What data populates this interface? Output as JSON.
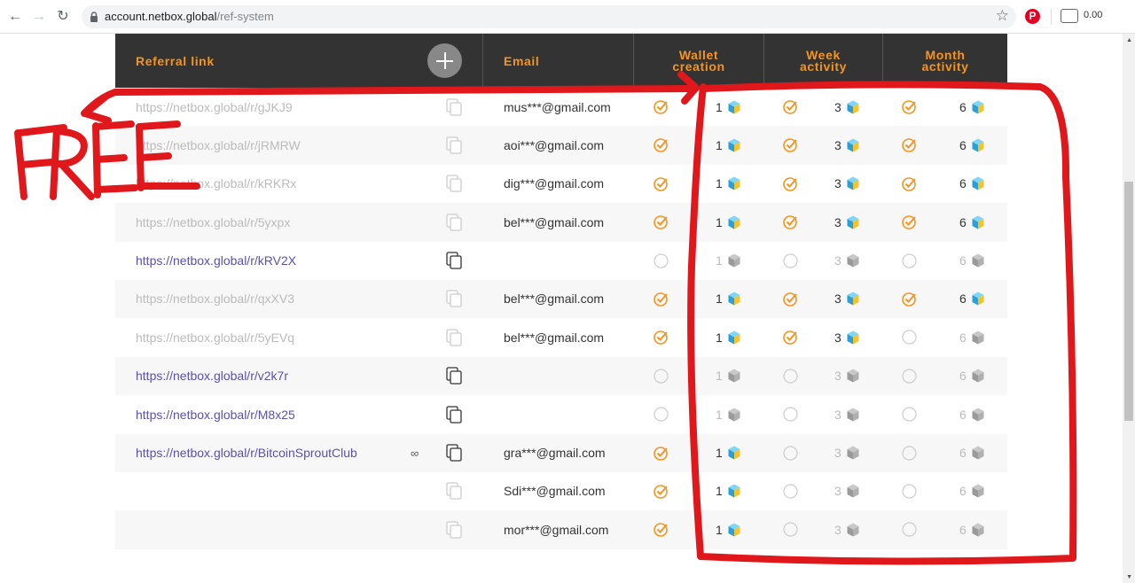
{
  "browser": {
    "back_icon": "arrow-left-icon",
    "forward_icon": "arrow-right-icon",
    "reload_icon": "reload-icon",
    "url_host": "account.netbox.global",
    "url_path": "/ref-system",
    "extension_value": "0.00"
  },
  "table": {
    "headers": {
      "referral_link": "Referral link",
      "email": "Email",
      "wallet_line1": "Wallet",
      "wallet_line2": "creation",
      "week_line1": "Week",
      "week_line2": "activity",
      "month_line1": "Month",
      "month_line2": "activity"
    },
    "rows": [
      {
        "link": "https://netbox.global/r/gJKJ9",
        "email": "mus***@gmail.com",
        "active": false,
        "infinity": "",
        "wallet": true,
        "wallet_reward": "1",
        "week": true,
        "week_reward": "3",
        "month": true,
        "month_reward": "6"
      },
      {
        "link": "https://netbox.global/r/jRMRW",
        "email": "aoi***@gmail.com",
        "active": false,
        "infinity": "",
        "wallet": true,
        "wallet_reward": "1",
        "week": true,
        "week_reward": "3",
        "month": true,
        "month_reward": "6"
      },
      {
        "link": "https://netbox.global/r/kRKRx",
        "email": "dig***@gmail.com",
        "active": false,
        "infinity": "",
        "wallet": true,
        "wallet_reward": "1",
        "week": true,
        "week_reward": "3",
        "month": true,
        "month_reward": "6"
      },
      {
        "link": "https://netbox.global/r/5yxpx",
        "email": "bel***@gmail.com",
        "active": false,
        "infinity": "",
        "wallet": true,
        "wallet_reward": "1",
        "week": true,
        "week_reward": "3",
        "month": true,
        "month_reward": "6"
      },
      {
        "link": "https://netbox.global/r/kRV2X",
        "email": "",
        "active": true,
        "infinity": "",
        "wallet": false,
        "wallet_reward": "1",
        "week": false,
        "week_reward": "3",
        "month": false,
        "month_reward": "6"
      },
      {
        "link": "https://netbox.global/r/qxXV3",
        "email": "bel***@gmail.com",
        "active": false,
        "infinity": "",
        "wallet": true,
        "wallet_reward": "1",
        "week": true,
        "week_reward": "3",
        "month": true,
        "month_reward": "6"
      },
      {
        "link": "https://netbox.global/r/5yEVq",
        "email": "bel***@gmail.com",
        "active": false,
        "infinity": "",
        "wallet": true,
        "wallet_reward": "1",
        "week": true,
        "week_reward": "3",
        "month": false,
        "month_reward": "6"
      },
      {
        "link": "https://netbox.global/r/v2k7r",
        "email": "",
        "active": true,
        "infinity": "",
        "wallet": false,
        "wallet_reward": "1",
        "week": false,
        "week_reward": "3",
        "month": false,
        "month_reward": "6"
      },
      {
        "link": "https://netbox.global/r/M8x25",
        "email": "",
        "active": true,
        "infinity": "",
        "wallet": false,
        "wallet_reward": "1",
        "week": false,
        "week_reward": "3",
        "month": false,
        "month_reward": "6"
      },
      {
        "link": "https://netbox.global/r/BitcoinSproutClub",
        "email": "gra***@gmail.com",
        "active": true,
        "infinity": "∞",
        "wallet": true,
        "wallet_reward": "1",
        "week": false,
        "week_reward": "3",
        "month": false,
        "month_reward": "6"
      },
      {
        "link": "",
        "email": "Sdi***@gmail.com",
        "active": false,
        "infinity": "",
        "wallet": true,
        "wallet_reward": "1",
        "week": false,
        "week_reward": "3",
        "month": false,
        "month_reward": "6"
      },
      {
        "link": "",
        "email": "mor***@gmail.com",
        "active": false,
        "infinity": "",
        "wallet": true,
        "wallet_reward": "1",
        "week": false,
        "week_reward": "3",
        "month": false,
        "month_reward": "6"
      }
    ]
  },
  "annotation": {
    "text": "FREE",
    "color": "#e0181b"
  },
  "colors": {
    "accent": "#f7941d",
    "header_bg": "#333333",
    "link_active": "#5b4fb0",
    "cube_active": "#29a8e0"
  }
}
